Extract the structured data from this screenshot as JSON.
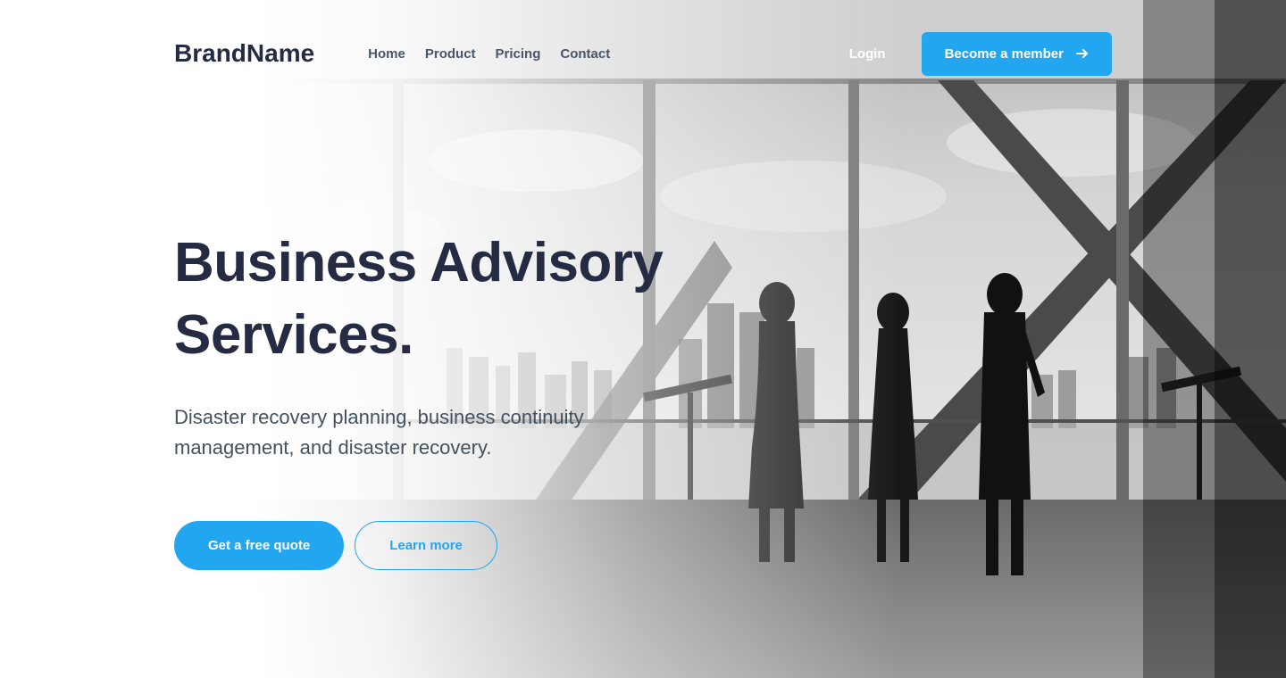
{
  "header": {
    "brand": "BrandName",
    "nav": [
      "Home",
      "Product",
      "Pricing",
      "Contact"
    ],
    "login": "Login",
    "cta": "Become a member"
  },
  "hero": {
    "title_line1": "Business Advisory",
    "title_line2": "Services.",
    "subtitle": "Disaster recovery planning, business continuity management, and disaster recovery.",
    "primary_cta": "Get a free quote",
    "secondary_cta": "Learn more"
  },
  "colors": {
    "primary": "#23A6F0",
    "text_dark": "#252B42",
    "text_muted": "#737373"
  }
}
